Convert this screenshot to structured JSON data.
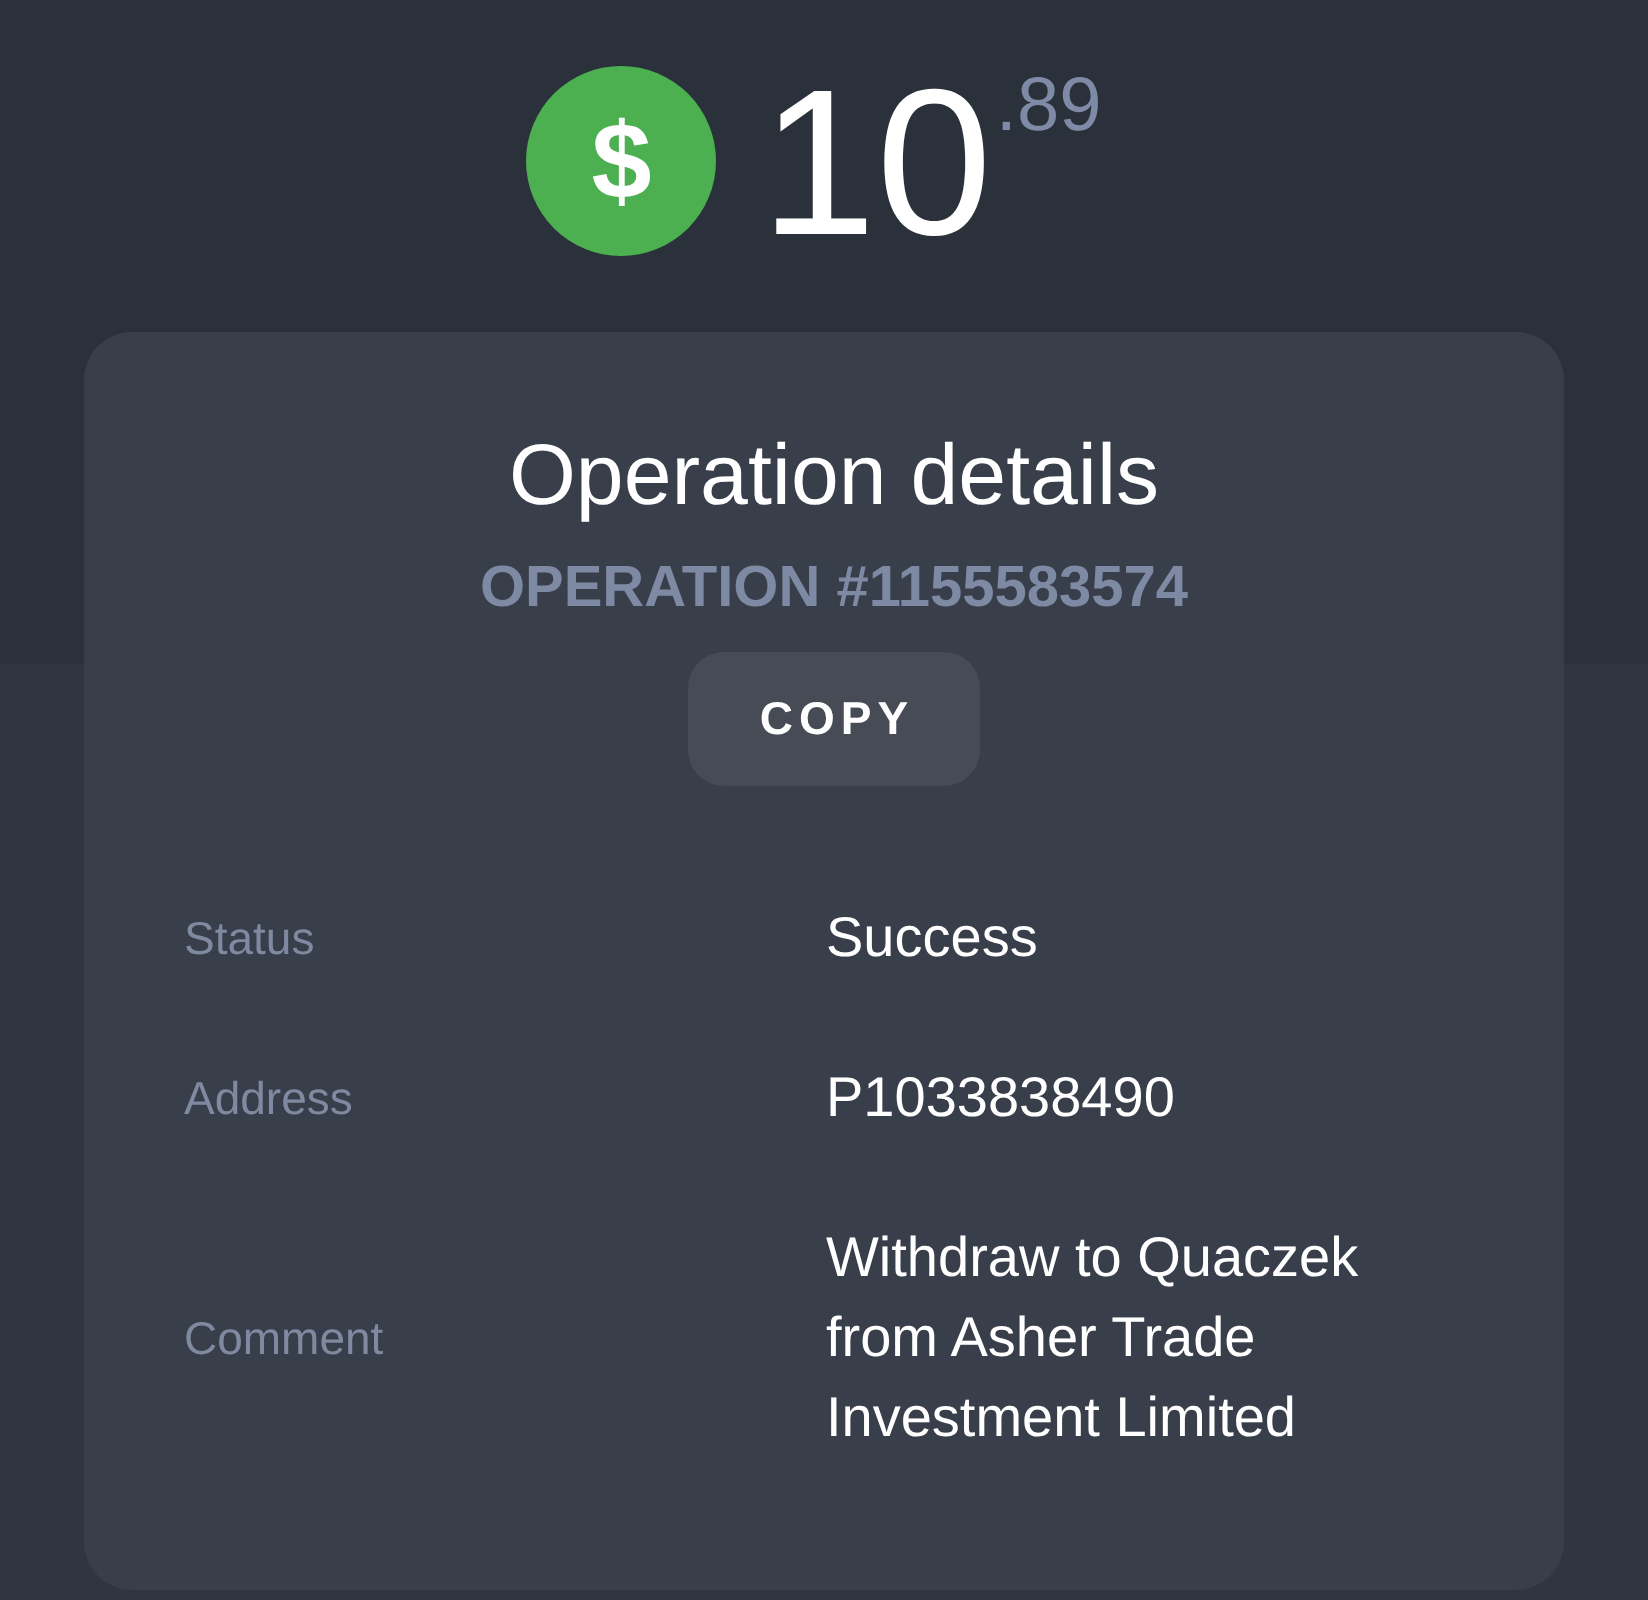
{
  "balance": {
    "currency_symbol": "$",
    "amount": "10$^{.89}$"
  },
  "card": {
    "title": "Operation details",
    "operation_number": "OPERATION #1155583574",
    "copy_button": "COPY",
    "details": [
      {
        "label": "Status",
        "value": "Success"
      },
      {
        "label": "Address",
        "value": "P1033838490"
      },
      {
        "label": "Comment",
        "value": "Withdraw to Quaczek from Asher Trade Investment Limited"
      }
    ]
  }
}
